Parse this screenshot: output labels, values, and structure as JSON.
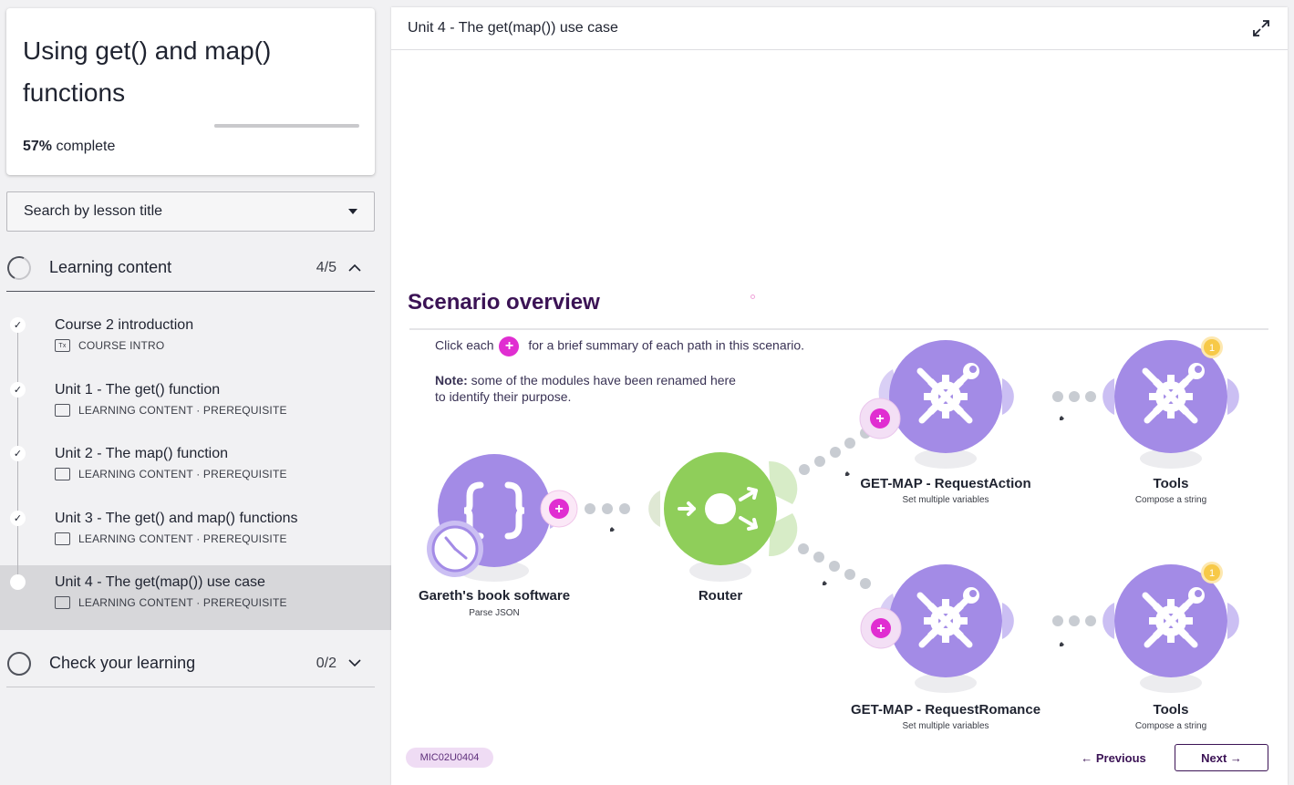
{
  "course": {
    "title": "Using get() and map() functions",
    "progress_percent": 57,
    "progress_value": "57%",
    "progress_suffix": " complete"
  },
  "search": {
    "placeholder": "Search by lesson title"
  },
  "sections": [
    {
      "title": "Learning content",
      "count": "4/5",
      "expanded": true
    },
    {
      "title": "Check your learning",
      "count": "0/2",
      "expanded": false
    }
  ],
  "lessons": [
    {
      "title": "Course 2 introduction",
      "meta": "COURSE INTRO",
      "icon": "document-icon",
      "completed": true
    },
    {
      "title": "Unit 1 - The get() function",
      "meta": "LEARNING CONTENT · PREREQUISITE",
      "icon": "slides-icon",
      "completed": true
    },
    {
      "title": "Unit 2 - The map() function",
      "meta": "LEARNING CONTENT · PREREQUISITE",
      "icon": "slides-icon",
      "completed": true
    },
    {
      "title": "Unit 3 - The get() and map() functions",
      "meta": "LEARNING CONTENT · PREREQUISITE",
      "icon": "slides-icon",
      "completed": true
    },
    {
      "title": "Unit 4 - The get(map()) use case",
      "meta": "LEARNING CONTENT · PREREQUISITE",
      "icon": "slides-icon",
      "completed": false,
      "active": true
    }
  ],
  "main": {
    "header_title": "Unit 4 - The get(map()) use case",
    "slide_title": "Scenario overview",
    "instruction_prefix": "Click each",
    "instruction_suffix": "for a brief summary of each path in this scenario.",
    "note_label": "Note:",
    "note_line1": " some of the modules have been renamed here",
    "note_line2": "to identify their purpose.",
    "plus_symbol": "+",
    "slide_code": "MIC02U0404",
    "prev_label": "← Previous",
    "next_label": "Next →"
  },
  "diagram": {
    "modules": [
      {
        "label": "Gareth's book software",
        "sub": "Parse JSON",
        "icon": "json-braces-icon"
      },
      {
        "label": "Router",
        "sub": "",
        "icon": "router-icon"
      },
      {
        "label": "GET-MAP - RequestAction",
        "sub": "Set multiple variables",
        "icon": "tools-icon"
      },
      {
        "label": "Tools",
        "sub": "Compose a string",
        "icon": "tools-icon",
        "badge": "1"
      },
      {
        "label": "GET-MAP - RequestRomance",
        "sub": "Set multiple variables",
        "icon": "tools-icon"
      },
      {
        "label": "Tools",
        "sub": "Compose a string",
        "icon": "tools-icon",
        "badge": "1"
      }
    ]
  },
  "colors": {
    "accent_purple": "#3b1355",
    "module_purple": "#a38be6",
    "router_green": "#8fce5a",
    "plus_magenta": "#e02ed1",
    "badge_orange": "#f7c948"
  }
}
